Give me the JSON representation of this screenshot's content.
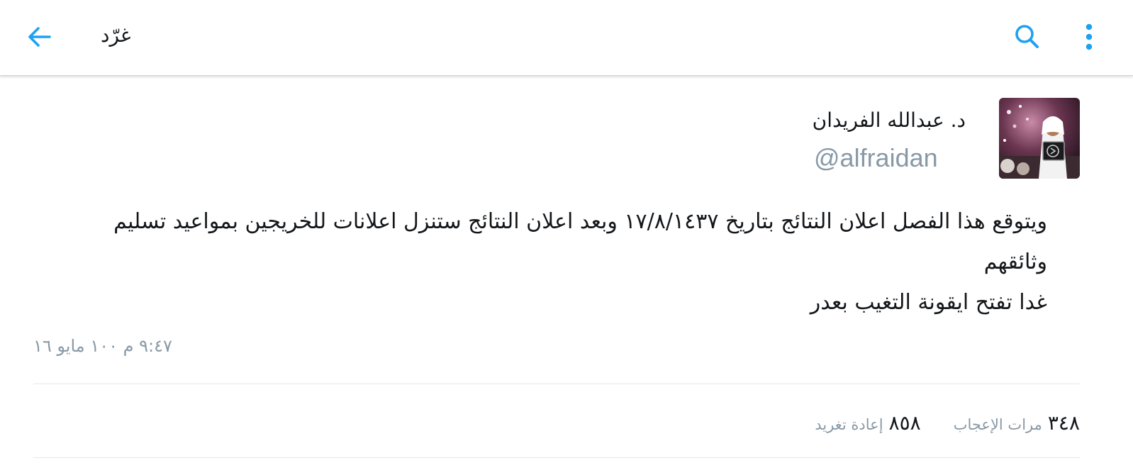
{
  "header": {
    "title": "غرّد",
    "back_icon": "arrow-left-icon",
    "search_icon": "search-icon",
    "more_icon": "more-vertical-icon",
    "accent_color": "#1da1f2"
  },
  "author": {
    "name": "د. عبدالله الفريدان",
    "handle": "@alfraidan",
    "avatar": "user-photo"
  },
  "tweet": {
    "line1": "ويتوقع هذا الفصل اعلان النتائج بتاريخ ١٧/٨/١٤٣٧ وبعد اعلان النتائج ستنزل اعلانات  للخريجين بمواعيد تسليم",
    "line2": "وثائقهم",
    "line3": "غدا تفتح ايقونة التغيب بعدر",
    "timestamp": "٩:٤٧ م ١٠٠ مايو ١٦"
  },
  "stats": {
    "retweets_count": "٨٥٨",
    "retweets_label": "إعادة تغريد",
    "likes_count": "٣٤٨",
    "likes_label": "مرات الإعجاب"
  }
}
